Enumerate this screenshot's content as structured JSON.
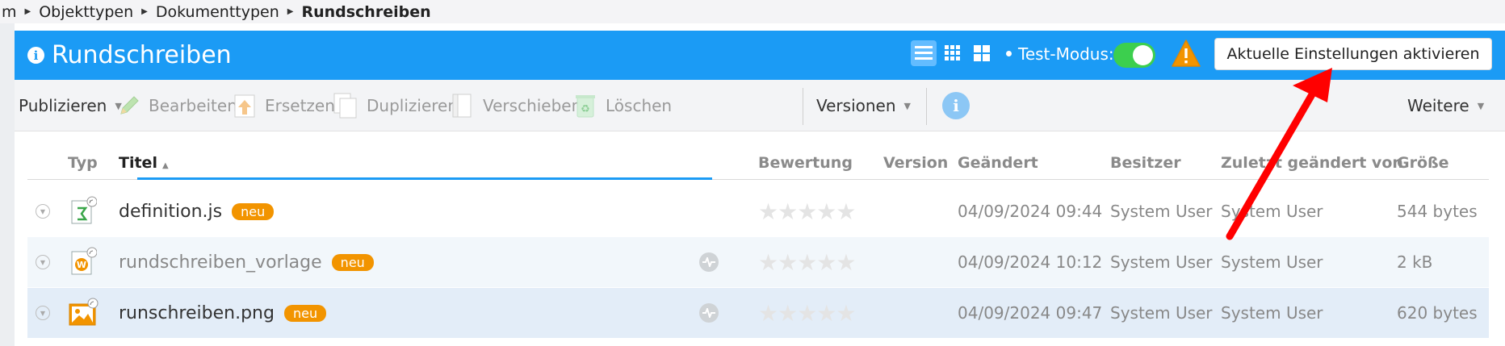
{
  "breadcrumb": {
    "items": [
      "m",
      "Objekttypen",
      "Dokumenttypen"
    ],
    "current": "Rundschreiben"
  },
  "header": {
    "title": "Rundschreiben",
    "test_mode_label": "Test-Modus:",
    "test_mode_on": true,
    "activate_button": "Aktuelle Einstellungen aktivieren",
    "accent": "#1b9bf5"
  },
  "toolbar": {
    "publish": "Publizieren",
    "edit": "Bearbeiten",
    "replace": "Ersetzen",
    "duplicate": "Duplizieren",
    "move": "Verschieben",
    "delete": "Löschen",
    "versions": "Versionen",
    "more": "Weitere"
  },
  "table": {
    "columns": {
      "type": "Typ",
      "title": "Titel",
      "rating": "Bewertung",
      "version": "Version",
      "changed": "Geändert",
      "owner": "Besitzer",
      "last_changed_by": "Zuletzt geändert von",
      "size": "Größe"
    },
    "rows": [
      {
        "icon": "script-file-icon",
        "title": "definition.js",
        "badge": "neu",
        "rating": "★★★★★",
        "changed": "04/09/2024 09:44",
        "owner": "System User",
        "last_changed_by": "System User",
        "size": "544 bytes"
      },
      {
        "icon": "word-file-icon",
        "title": "rundschreiben_vorlage",
        "badge": "neu",
        "rating": "★★★★★",
        "changed": "04/09/2024 10:12",
        "owner": "System User",
        "last_changed_by": "System User",
        "size": "2 kB"
      },
      {
        "icon": "image-file-icon",
        "title": "runschreiben.png",
        "badge": "neu",
        "rating": "★★★★★",
        "changed": "04/09/2024 09:47",
        "owner": "System User",
        "last_changed_by": "System User",
        "size": "620 bytes"
      }
    ]
  },
  "colors": {
    "badge": "#f29400",
    "annotation_arrow": "#ff0000",
    "row_alt": "#f2f7fb",
    "row_selected": "#e3edf8"
  }
}
